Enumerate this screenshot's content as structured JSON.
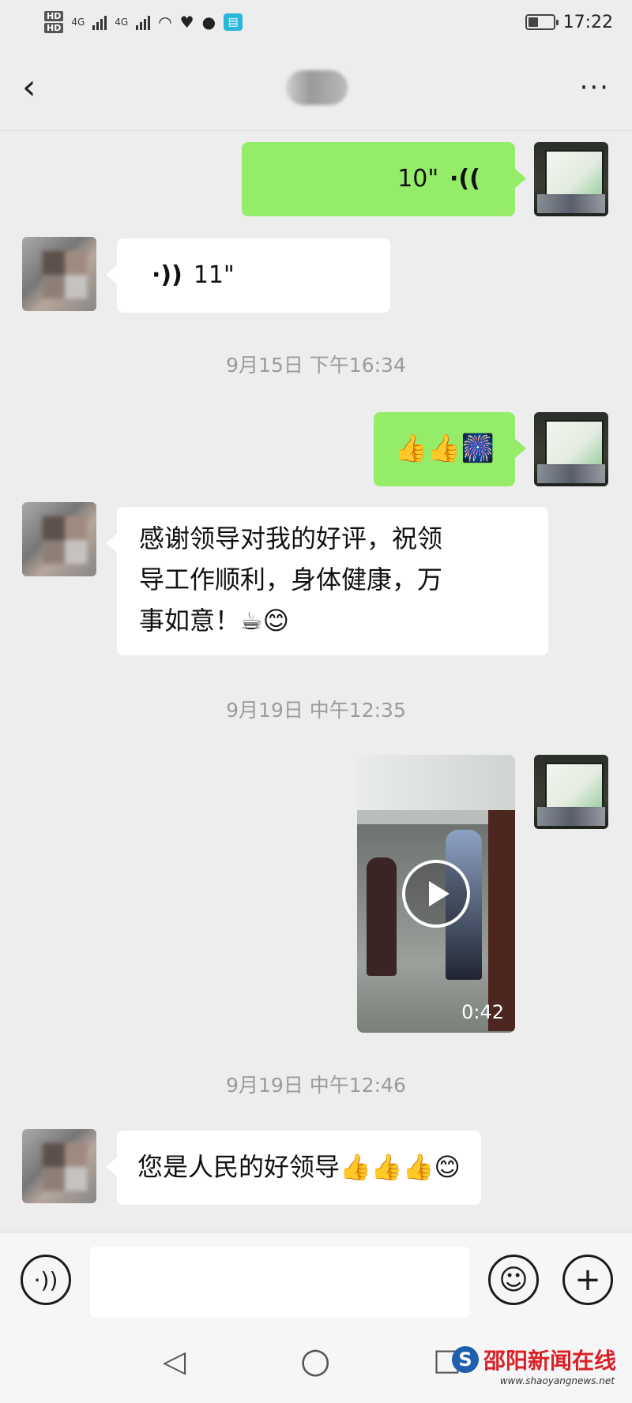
{
  "status_bar": {
    "hd_labels": [
      "HD",
      "HD"
    ],
    "network_labels": [
      "4G",
      "4G"
    ],
    "time": "17:22",
    "battery_level": 0.4
  },
  "header": {
    "title": "",
    "back_icon": "chevron-left-icon",
    "more_icon": "more-dots-icon"
  },
  "messages": [
    {
      "type": "voice",
      "sender": "me",
      "duration": "10\""
    },
    {
      "type": "voice",
      "sender": "peer",
      "duration": "11\""
    },
    {
      "type": "timestamp",
      "text": "9月15日 下午16:34"
    },
    {
      "type": "text",
      "sender": "me",
      "text": "👍👍🎆"
    },
    {
      "type": "text",
      "sender": "peer",
      "lines": [
        "感谢领导对我的好评，祝领",
        "导工作顺利，身体健康，万",
        "事如意！☕😊"
      ]
    },
    {
      "type": "timestamp",
      "text": "9月19日 中午12:35"
    },
    {
      "type": "video",
      "sender": "me",
      "duration": "0:42"
    },
    {
      "type": "timestamp",
      "text": "9月19日 中午12:46"
    },
    {
      "type": "text",
      "sender": "peer",
      "text": "您是人民的好领导👍👍👍😊"
    }
  ],
  "input_bar": {
    "voice_icon": "voice-mode-icon",
    "emoji_icon": "smiley-icon",
    "plus_icon": "plus-icon",
    "placeholder": ""
  },
  "system_nav": {
    "back": "◁",
    "home": "○",
    "recents": "□"
  },
  "watermark": {
    "brand": "邵阳新闻在线",
    "url": "www.shaoyangnews.net"
  }
}
